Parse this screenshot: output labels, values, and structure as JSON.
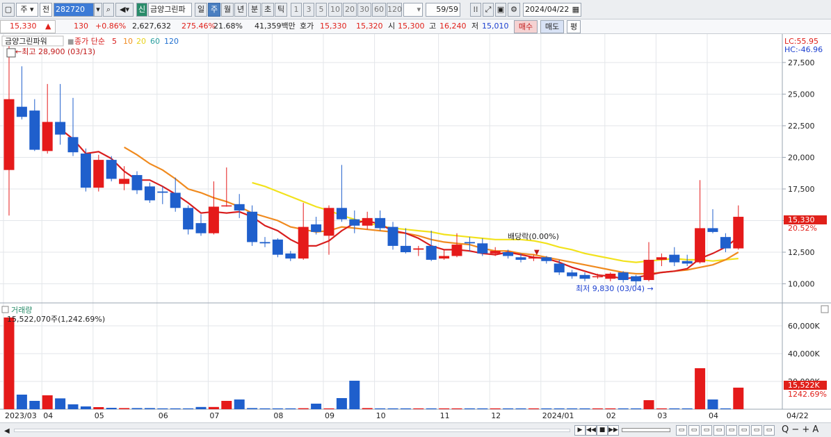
{
  "toolbar": {
    "market": "주",
    "prev_label": "전",
    "code": "282720",
    "new_badge": "신",
    "stock_name": "금양그린파",
    "periods": [
      "일",
      "주",
      "월",
      "년",
      "분",
      "초",
      "틱"
    ],
    "active_period": "주",
    "intervals": [
      "1",
      "3",
      "5",
      "10",
      "20",
      "30",
      "60",
      "120"
    ],
    "count": "59/59",
    "date": "2024/04/22"
  },
  "quote": {
    "price": "15,330",
    "change_arrow": "▲",
    "change": "130",
    "change_pct": "+0.86%",
    "volume": "2,627,632",
    "vol_ratio": "275.46%",
    "turnover": "21.68%",
    "amount": "41,359백만",
    "bid_label": "호가",
    "ask": "15,330",
    "bid": "15,320",
    "open_label": "시",
    "open": "15,300",
    "high_label": "고",
    "high": "16,240",
    "low_label": "저",
    "low": "15,010",
    "buy_button": "매수",
    "sell_button": "매도",
    "eval_button": "평"
  },
  "price_panel": {
    "title": "금양그린파워",
    "ma_prefix": "종가 단순",
    "ma_periods": [
      "5",
      "10",
      "20",
      "60",
      "120"
    ],
    "ma_colors": [
      "#d81e1e",
      "#f08a1e",
      "#f2e21c",
      "#2aa0a0",
      "#1f6fd0"
    ],
    "high_note": "←최고 28,900 (03/13)",
    "low_note": "최저 9,830 (03/04) →",
    "dividend_note": "배당락(0.00%)",
    "lc": "LC:55.95",
    "hc": "HC:-46.96",
    "last_price_label": "15,330",
    "last_pct_label": "20.52%",
    "y_ticks": [
      "27,500",
      "25,000",
      "22,500",
      "20,000",
      "17,500",
      "15,000",
      "12,500",
      "10,000"
    ]
  },
  "volume_panel": {
    "title": "거래량",
    "value_note": "15,522,070주(1,242.69%)",
    "y_ticks": [
      "60,000K",
      "40,000K",
      "20,000K"
    ],
    "last_label": "15,522K",
    "last_pct": "1242.69%"
  },
  "x_axis": {
    "labels": [
      "2023/03",
      "04",
      "05",
      "06",
      "07",
      "08",
      "09",
      "10",
      "11",
      "12",
      "2024/01",
      "02",
      "03",
      "04"
    ],
    "end_label": "04/22"
  },
  "chart_data": {
    "type": "candlestick",
    "up_color": "#e51a1a",
    "down_color": "#1f5fcc",
    "candles": [
      {
        "o": 19000,
        "c": 24600,
        "h": 28900,
        "l": 15400
      },
      {
        "o": 24000,
        "c": 23200,
        "h": 27200,
        "l": 23000
      },
      {
        "o": 23700,
        "c": 20600,
        "h": 24600,
        "l": 20500
      },
      {
        "o": 20500,
        "c": 22800,
        "h": 25800,
        "l": 20300
      },
      {
        "o": 22800,
        "c": 21800,
        "h": 25800,
        "l": 21000
      },
      {
        "o": 21600,
        "c": 20400,
        "h": 24700,
        "l": 20100
      },
      {
        "o": 20300,
        "c": 17600,
        "h": 20700,
        "l": 17300
      },
      {
        "o": 17600,
        "c": 19800,
        "h": 20200,
        "l": 17300
      },
      {
        "o": 19800,
        "c": 18300,
        "h": 20100,
        "l": 18100
      },
      {
        "o": 17900,
        "c": 18300,
        "h": 19300,
        "l": 17400
      },
      {
        "o": 18600,
        "c": 17400,
        "h": 18900,
        "l": 17100
      },
      {
        "o": 17700,
        "c": 16600,
        "h": 18000,
        "l": 16400
      },
      {
        "o": 17300,
        "c": 17200,
        "h": 17700,
        "l": 16300
      },
      {
        "o": 17200,
        "c": 16000,
        "h": 18400,
        "l": 15700
      },
      {
        "o": 16000,
        "c": 14300,
        "h": 16200,
        "l": 13900
      },
      {
        "o": 14800,
        "c": 14000,
        "h": 15500,
        "l": 13800
      },
      {
        "o": 14000,
        "c": 16100,
        "h": 18100,
        "l": 13900
      },
      {
        "o": 16200,
        "c": 16200,
        "h": 19200,
        "l": 16100
      },
      {
        "o": 16300,
        "c": 15800,
        "h": 17100,
        "l": 15200
      },
      {
        "o": 15700,
        "c": 13300,
        "h": 16200,
        "l": 13000
      },
      {
        "o": 13300,
        "c": 13200,
        "h": 13700,
        "l": 12900
      },
      {
        "o": 13500,
        "c": 12300,
        "h": 13600,
        "l": 12100
      },
      {
        "o": 12400,
        "c": 12000,
        "h": 12600,
        "l": 11800
      },
      {
        "o": 12000,
        "c": 14500,
        "h": 16400,
        "l": 11900
      },
      {
        "o": 14700,
        "c": 14100,
        "h": 15300,
        "l": 13900
      },
      {
        "o": 13800,
        "c": 16000,
        "h": 16200,
        "l": 12300
      },
      {
        "o": 16000,
        "c": 15100,
        "h": 19400,
        "l": 14900
      },
      {
        "o": 15100,
        "c": 14600,
        "h": 15800,
        "l": 14000
      },
      {
        "o": 14600,
        "c": 15200,
        "h": 15700,
        "l": 14300
      },
      {
        "o": 15200,
        "c": 14400,
        "h": 15800,
        "l": 14200
      },
      {
        "o": 14500,
        "c": 13000,
        "h": 14900,
        "l": 12700
      },
      {
        "o": 13000,
        "c": 12500,
        "h": 14400,
        "l": 12400
      },
      {
        "o": 12700,
        "c": 12800,
        "h": 13000,
        "l": 12200
      },
      {
        "o": 13000,
        "c": 11900,
        "h": 14200,
        "l": 11800
      },
      {
        "o": 12000,
        "c": 12200,
        "h": 12700,
        "l": 11900
      },
      {
        "o": 12200,
        "c": 13100,
        "h": 14000,
        "l": 12100
      },
      {
        "o": 13300,
        "c": 13200,
        "h": 13700,
        "l": 12600
      },
      {
        "o": 13200,
        "c": 12400,
        "h": 13600,
        "l": 12200
      },
      {
        "o": 12400,
        "c": 12600,
        "h": 12900,
        "l": 12200
      },
      {
        "o": 12500,
        "c": 12200,
        "h": 12700,
        "l": 12000
      },
      {
        "o": 12100,
        "c": 11900,
        "h": 12400,
        "l": 11700
      },
      {
        "o": 12000,
        "c": 12100,
        "h": 12300,
        "l": 11800
      },
      {
        "o": 12100,
        "c": 11800,
        "h": 12200,
        "l": 11600
      },
      {
        "o": 11600,
        "c": 10900,
        "h": 11900,
        "l": 10700
      },
      {
        "o": 10900,
        "c": 10600,
        "h": 11100,
        "l": 10400
      },
      {
        "o": 10700,
        "c": 10400,
        "h": 10900,
        "l": 10200
      },
      {
        "o": 10600,
        "c": 10600,
        "h": 10800,
        "l": 10400
      },
      {
        "o": 10400,
        "c": 10800,
        "h": 10900,
        "l": 10200
      },
      {
        "o": 10900,
        "c": 10300,
        "h": 11000,
        "l": 10100
      },
      {
        "o": 10600,
        "c": 10200,
        "h": 10700,
        "l": 9830
      },
      {
        "o": 10300,
        "c": 11900,
        "h": 13300,
        "l": 10200
      },
      {
        "o": 11900,
        "c": 12100,
        "h": 12400,
        "l": 11400
      },
      {
        "o": 12300,
        "c": 11700,
        "h": 12900,
        "l": 11400
      },
      {
        "o": 11800,
        "c": 11600,
        "h": 12300,
        "l": 11400
      },
      {
        "o": 11700,
        "c": 14400,
        "h": 18200,
        "l": 11600
      },
      {
        "o": 14400,
        "c": 14100,
        "h": 15900,
        "l": 14000
      },
      {
        "o": 13700,
        "c": 12800,
        "h": 14000,
        "l": 12500
      },
      {
        "o": 12800,
        "c": 15300,
        "h": 16200,
        "l": 12700
      }
    ],
    "ma5": [
      null,
      null,
      null,
      null,
      22250,
      21450,
      20300,
      20450,
      19900,
      18900,
      18200,
      18200,
      17700,
      17100,
      16400,
      15600,
      15700,
      15600,
      15700,
      15300,
      14600,
      14200,
      13500,
      13000,
      13000,
      13400,
      14200,
      14800,
      15000,
      14700,
      14200,
      14000,
      13600,
      13000,
      12700,
      12700,
      12600,
      12400,
      12300,
      12500,
      12300,
      12100,
      12000,
      11700,
      11300,
      11000,
      10700,
      10600,
      10400,
      10500,
      10700,
      10900,
      11000,
      11200,
      12000,
      12400,
      12900,
      13700
    ],
    "ma10": [
      null,
      null,
      null,
      null,
      null,
      null,
      null,
      null,
      null,
      20800,
      20200,
      19500,
      19000,
      18300,
      17500,
      17200,
      16800,
      16500,
      16100,
      15600,
      15300,
      15000,
      14500,
      14300,
      14100,
      14200,
      14500,
      14400,
      14300,
      14200,
      14100,
      14000,
      13800,
      13500,
      13300,
      13200,
      13100,
      12800,
      12600,
      12600,
      12400,
      12300,
      12100,
      11900,
      11700,
      11500,
      11300,
      11100,
      10900,
      10800,
      10800,
      10900,
      11000,
      11100,
      11300,
      11500,
      11900,
      12500
    ],
    "ma20": [
      null,
      null,
      null,
      null,
      null,
      null,
      null,
      null,
      null,
      null,
      null,
      null,
      null,
      null,
      null,
      null,
      null,
      null,
      null,
      18000,
      17700,
      17300,
      16900,
      16500,
      16100,
      15800,
      15400,
      15100,
      14800,
      14600,
      14400,
      14300,
      14200,
      14100,
      13900,
      13800,
      13700,
      13600,
      13500,
      13500,
      13500,
      13400,
      13200,
      12900,
      12700,
      12400,
      12200,
      12000,
      11800,
      11700,
      11800,
      11900,
      12000,
      11900,
      11900,
      11800,
      11900,
      12000
    ],
    "volumes": [
      66000,
      10500,
      6000,
      10000,
      7800,
      3500,
      2000,
      1500,
      1000,
      800,
      800,
      800,
      600,
      600,
      600,
      1600,
      600,
      600,
      1300,
      800,
      600,
      600,
      600,
      700,
      600,
      600,
      700,
      800,
      800,
      600,
      600,
      600,
      600,
      600,
      600,
      600,
      600,
      600,
      600,
      600,
      600,
      600,
      600,
      600,
      600,
      600,
      600,
      600,
      600,
      600,
      600,
      600,
      600,
      600,
      600,
      600,
      600,
      600
    ],
    "vol_candles_idx": [
      0,
      1,
      2,
      3,
      4,
      5,
      6,
      7,
      8,
      9,
      10,
      11,
      12,
      13,
      14,
      15,
      16,
      17,
      18,
      19,
      20,
      21,
      22,
      23,
      24,
      25,
      26,
      27,
      28,
      29,
      30,
      31,
      32,
      33,
      34,
      35,
      36,
      37,
      38,
      39,
      40,
      41,
      42,
      43,
      44,
      45,
      46,
      47,
      48,
      49,
      50,
      51,
      52,
      53,
      54,
      55,
      56,
      57
    ],
    "volume_overrides": {
      "16": 1600,
      "17": 6000,
      "18": 7000,
      "24": 4000,
      "26": 8000,
      "27": 20500,
      "50": 6500,
      "54": 29500,
      "55": 7000,
      "57": 15522
    },
    "price_ylim": [
      8600,
      29200
    ],
    "volume_ylim": [
      0,
      70000
    ]
  }
}
